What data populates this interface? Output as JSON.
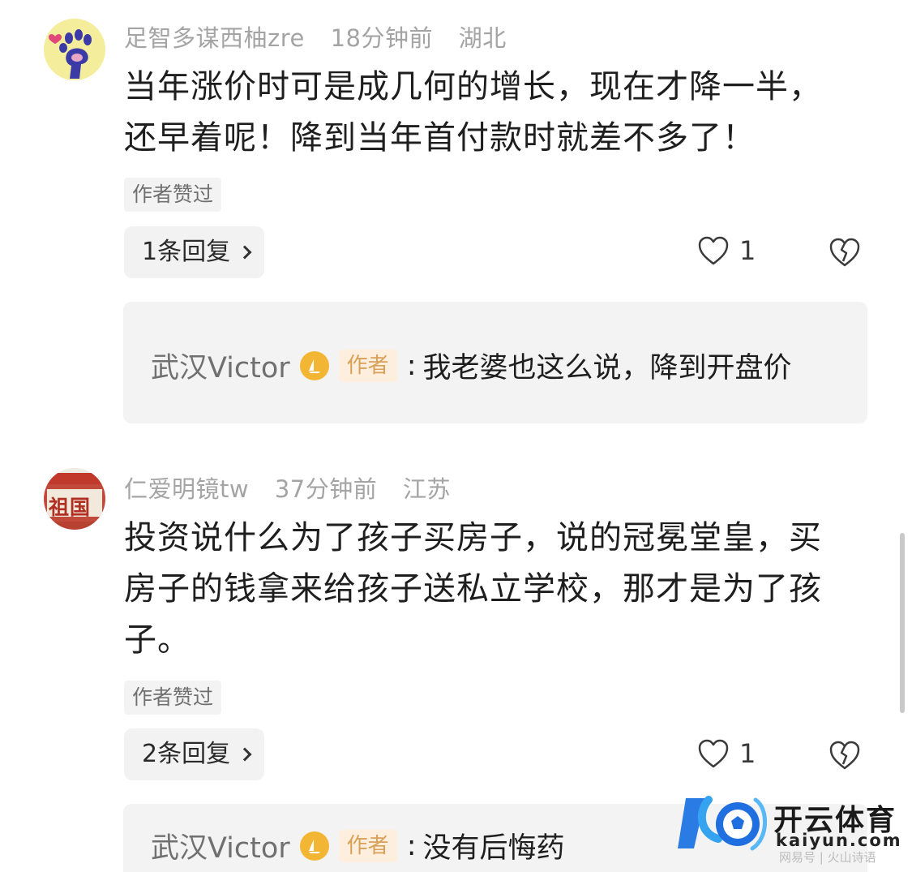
{
  "comments": [
    {
      "username": "足智多谋西柚zre",
      "time": "18分钟前",
      "location": "湖北",
      "lines": [
        "当年涨价时可是成几何的增长，现在才降一半，",
        "还早着呢！降到当年首付款时就差不多了！"
      ],
      "author_liked": "作者赞过",
      "replies_label": "1条回复",
      "likes": "1",
      "reply": {
        "name": "武汉Victor",
        "tag": "作者",
        "colon": ":",
        "text": "我老婆也这么说，降到开盘价"
      },
      "avatar_icon": "paw-icon"
    },
    {
      "username": "仁爱明镜tw",
      "time": "37分钟前",
      "location": "江苏",
      "lines": [
        "投资说什么为了孩子买房子，说的冠冕堂皇，买",
        "房子的钱拿来给孩子送私立学校，那才是为了孩",
        "子。"
      ],
      "author_liked": "作者赞过",
      "replies_label": "2条回复",
      "likes": "1",
      "reply": {
        "name": "武汉Victor",
        "tag": "作者",
        "colon": ":",
        "text": "没有后悔药"
      },
      "avatar_text": "祖国"
    }
  ],
  "watermark": {
    "title": "开云体育",
    "url": "kaiyun.com",
    "source": "网易号 | 火山诗语"
  },
  "colors": {
    "meta": "#a4a4a4",
    "author_tag_bg": "#fdeedd",
    "author_tag_text": "#d9a058",
    "medal": "#f3b634",
    "card_bg": "#f3f3f3"
  }
}
